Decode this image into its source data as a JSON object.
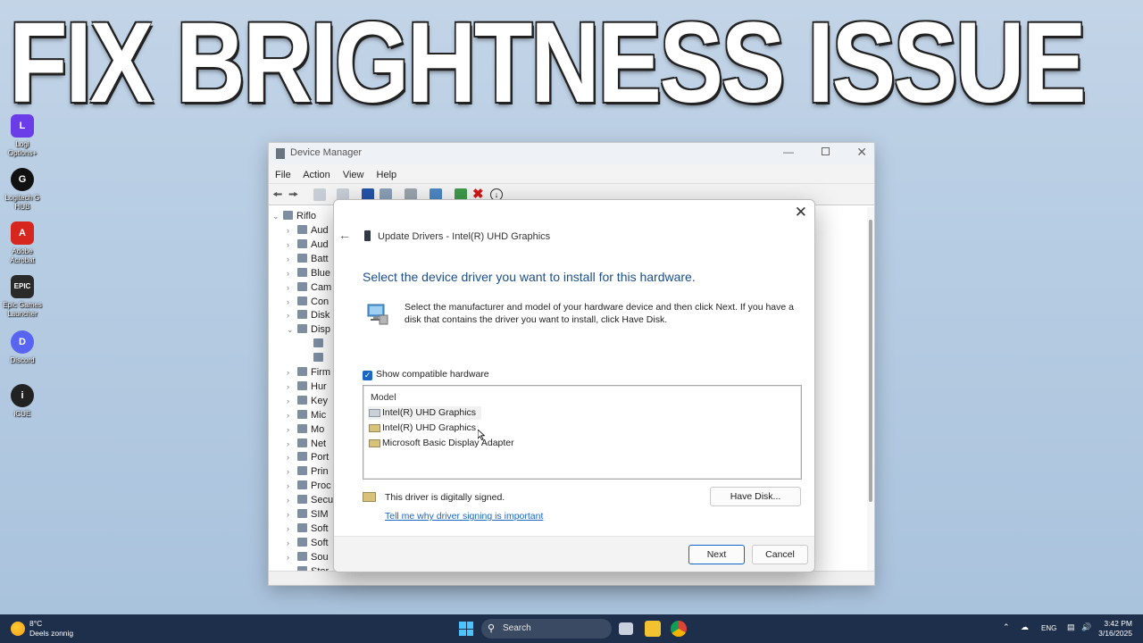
{
  "banner": {
    "title": "FIX BRIGHTNESS ISSUE"
  },
  "desktop": {
    "icons": [
      {
        "label": "Logi Options+",
        "symbol": "L",
        "color": "#6a3de8"
      },
      {
        "label": "Logitech G HUB",
        "symbol": "G",
        "color": "#111111"
      },
      {
        "label": "Adobe Acrobat",
        "symbol": "A",
        "color": "#d7261e"
      },
      {
        "label": "Epic Games Launcher",
        "symbol": "EPIC",
        "color": "#2a2a2a"
      },
      {
        "label": "Discord",
        "symbol": "D",
        "color": "#5865f2"
      },
      {
        "label": "iCUE",
        "symbol": "i",
        "color": "#222222"
      }
    ]
  },
  "device_manager": {
    "title": "Device Manager",
    "menu": [
      "File",
      "Action",
      "View",
      "Help"
    ],
    "tree_root": "Riflo",
    "tree_items": [
      "Aud",
      "Aud",
      "Batt",
      "Blue",
      "Cam",
      "Con",
      "Disk",
      "Disp",
      "",
      "",
      "Firm",
      "Hur",
      "Key",
      "Mic",
      "Mo",
      "Net",
      "Port",
      "Prin",
      "Proc",
      "Secu",
      "SIM",
      "Soft",
      "Soft",
      "Sou",
      "Stor"
    ]
  },
  "dialog": {
    "header": "Update Drivers - Intel(R) UHD Graphics",
    "heading": "Select the device driver you want to install for this hardware.",
    "description": "Select the manufacturer and model of your hardware device and then click Next. If you have a disk that contains the driver you want to install, click Have Disk.",
    "show_compatible": {
      "label": "Show compatible hardware",
      "checked": true
    },
    "model_header": "Model",
    "models": [
      "Intel(R) UHD Graphics",
      "Intel(R) UHD Graphics",
      "Microsoft Basic Display Adapter"
    ],
    "selected_model_index": 0,
    "signed_text": "This driver is digitally signed.",
    "signing_link": "Tell me why driver signing is important",
    "have_disk": "Have Disk...",
    "next": "Next",
    "cancel": "Cancel"
  },
  "taskbar": {
    "temperature": "8°C",
    "weather": "Deels zonnig",
    "search_placeholder": "Search",
    "language": "ENG",
    "time": "3:42 PM",
    "date": "3/16/2025"
  }
}
